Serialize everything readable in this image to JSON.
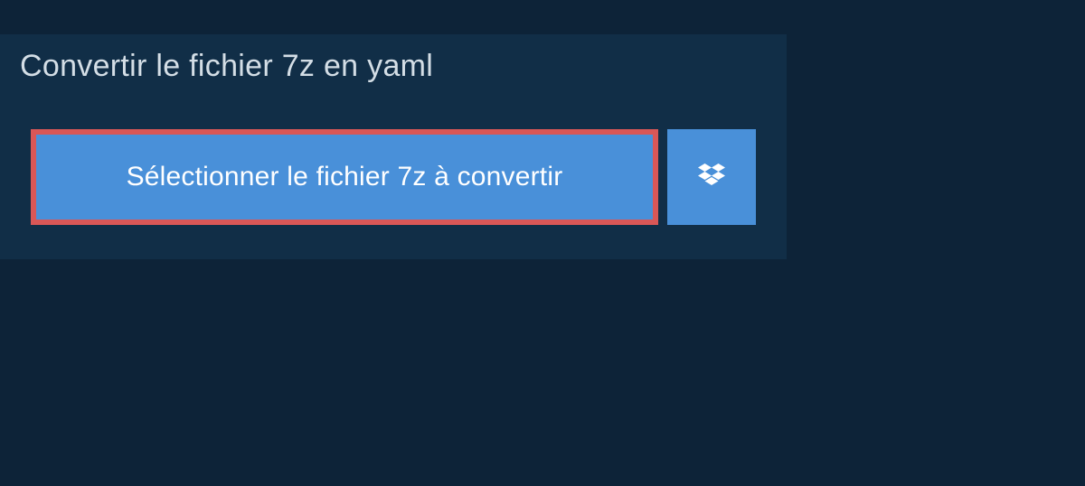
{
  "header": {
    "title": "Convertir le fichier 7z en yaml"
  },
  "actions": {
    "select_file_label": "Sélectionner le fichier 7z à convertir"
  }
}
